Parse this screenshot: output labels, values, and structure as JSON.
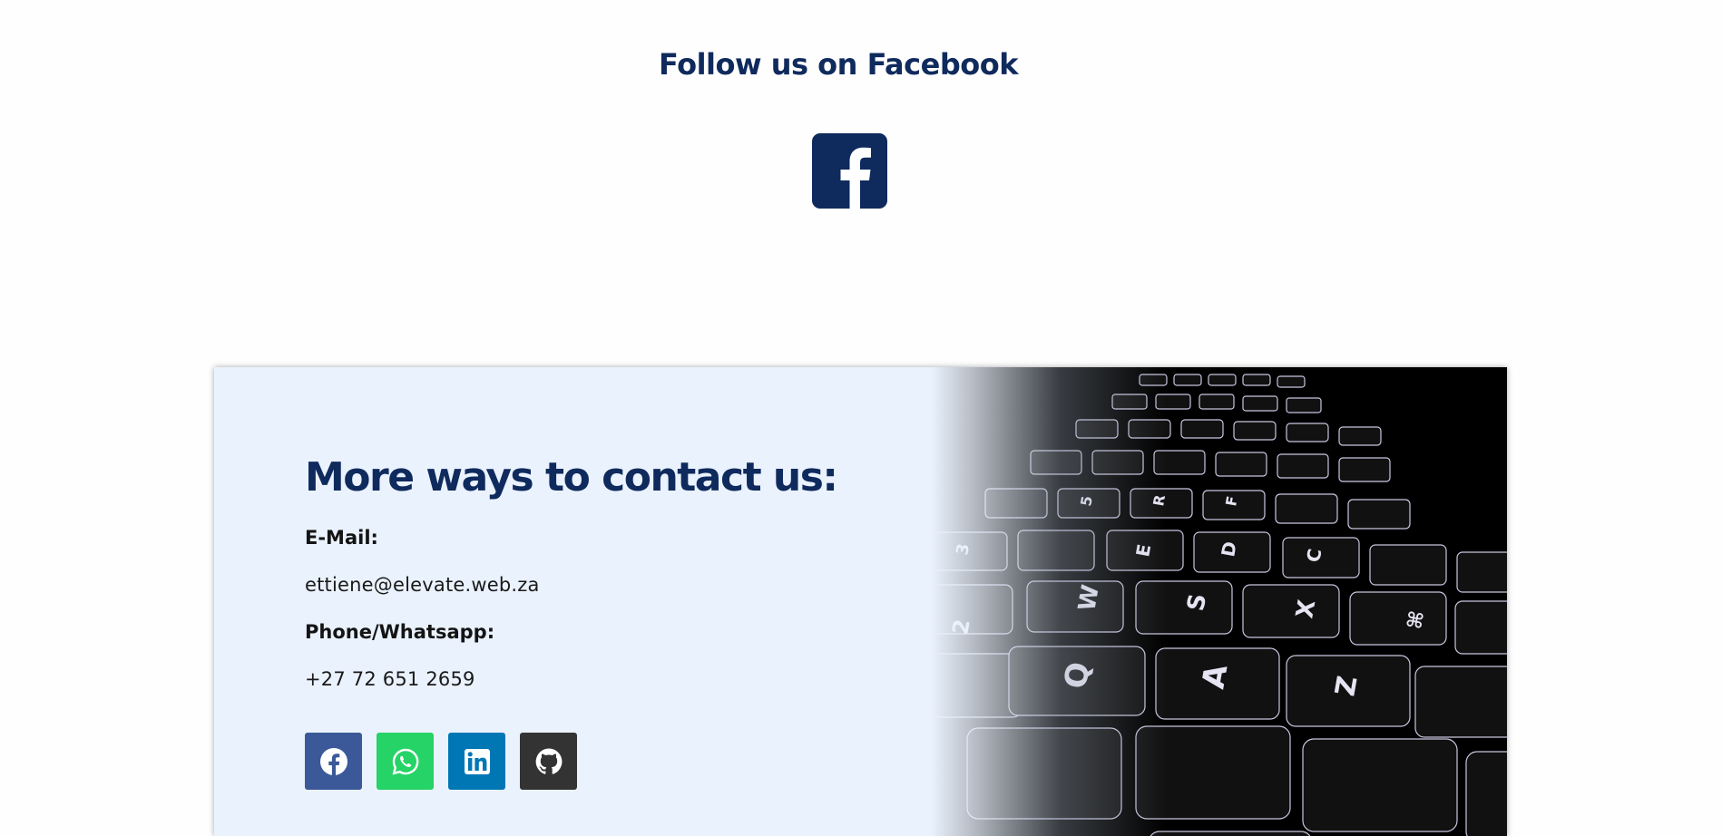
{
  "follow_section": {
    "title": "Follow us on Facebook",
    "icon": "facebook-square-icon",
    "icon_color": "#0f2a5c"
  },
  "contact_section": {
    "heading": "More ways to contact us:",
    "email_label": "E-Mail:",
    "email_value": "ettiene@elevate.web.za",
    "phone_label": "Phone/Whatsapp:",
    "phone_value": "+27 72 651 2659",
    "background_color": "#eaf2fd",
    "heading_color": "#0f2a5c",
    "image": "backlit-keyboard-photo",
    "socials": [
      {
        "name": "facebook",
        "icon": "facebook-icon",
        "color": "#3b5998"
      },
      {
        "name": "whatsapp",
        "icon": "whatsapp-icon",
        "color": "#25d366"
      },
      {
        "name": "linkedin",
        "icon": "linkedin-icon",
        "color": "#0077b5"
      },
      {
        "name": "github",
        "icon": "github-icon",
        "color": "#333333"
      }
    ]
  }
}
